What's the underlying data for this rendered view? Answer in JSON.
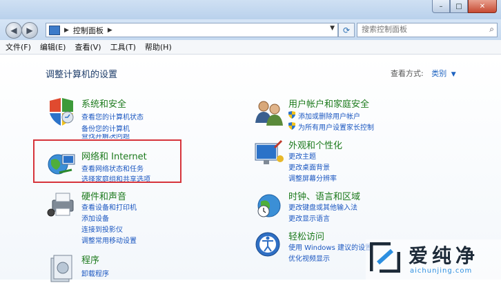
{
  "address": {
    "crumb": "控制面板"
  },
  "search": {
    "placeholder": "搜索控制面板"
  },
  "menu": [
    "文件(F)",
    "编辑(E)",
    "查看(V)",
    "工具(T)",
    "帮助(H)"
  ],
  "page_title": "调整计算机的设置",
  "view_by": {
    "label": "查看方式:",
    "value": "类别"
  },
  "categories": {
    "system": {
      "title": "系统和安全",
      "links": [
        "查看您的计算机状态",
        "备份您的计算机",
        "查找并解决问题"
      ]
    },
    "network": {
      "title": "网络和 Internet",
      "links": [
        "查看网络状态和任务",
        "选择家庭组和共享选项"
      ]
    },
    "hardware": {
      "title": "硬件和声音",
      "links": [
        "查看设备和打印机",
        "添加设备",
        "连接到投影仪",
        "调整常用移动设置"
      ]
    },
    "programs": {
      "title": "程序",
      "links": [
        "卸载程序"
      ]
    },
    "users": {
      "title": "用户帐户和家庭安全",
      "links": [
        "添加或删除用户帐户",
        "为所有用户设置家长控制"
      ]
    },
    "appearance": {
      "title": "外观和个性化",
      "links": [
        "更改主题",
        "更改桌面背景",
        "调整屏幕分辨率"
      ]
    },
    "clock": {
      "title": "时钟、语言和区域",
      "links": [
        "更改键盘或其他输入法",
        "更改显示语言"
      ]
    },
    "access": {
      "title": "轻松访问",
      "links": [
        "使用 Windows 建议的设置",
        "优化视频显示"
      ]
    }
  },
  "watermark": {
    "text": "爱纯净",
    "url": "aichunjing.com"
  },
  "colors": {
    "link": "#1b57c1",
    "category": "#1c7a1c",
    "highlight": "#d6333a"
  }
}
